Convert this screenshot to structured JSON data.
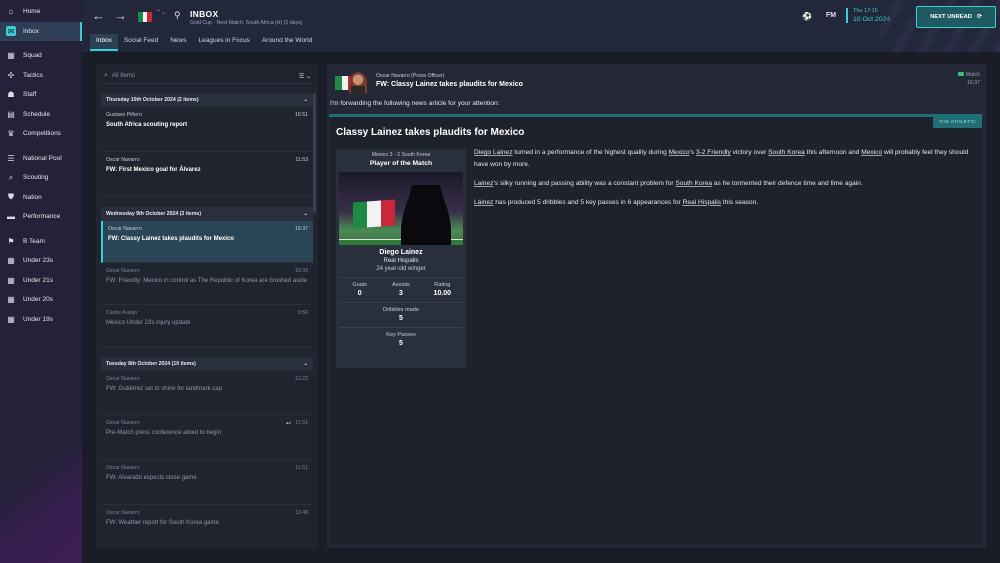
{
  "sidebar": {
    "items": [
      {
        "label": "Home",
        "icon": "home-icon",
        "glyph": "⌂"
      },
      {
        "label": "Inbox",
        "icon": "inbox-icon",
        "glyph": "✉"
      },
      {
        "label": "Squad",
        "icon": "squad-icon",
        "glyph": "▦"
      },
      {
        "label": "Tactics",
        "icon": "tactics-icon",
        "glyph": "✣"
      },
      {
        "label": "Staff",
        "icon": "staff-icon",
        "glyph": "☗"
      },
      {
        "label": "Schedule",
        "icon": "schedule-icon",
        "glyph": "▤"
      },
      {
        "label": "Competitions",
        "icon": "trophy-icon",
        "glyph": "♛"
      },
      {
        "label": "National Pool",
        "icon": "pool-icon",
        "glyph": "☰"
      },
      {
        "label": "Scouting",
        "icon": "scouting-icon",
        "glyph": "⌕"
      },
      {
        "label": "Nation",
        "icon": "nation-icon",
        "glyph": "⛊"
      },
      {
        "label": "Performance",
        "icon": "performance-icon",
        "glyph": "▬"
      },
      {
        "label": "B Team",
        "icon": "team-icon",
        "glyph": "⚑"
      },
      {
        "label": "Under 23s",
        "icon": "team-icon",
        "glyph": "▦"
      },
      {
        "label": "Under 21s",
        "icon": "team-icon",
        "glyph": "▦"
      },
      {
        "label": "Under 20s",
        "icon": "team-icon",
        "glyph": "▦"
      },
      {
        "label": "Under 19s",
        "icon": "team-icon",
        "glyph": "▦"
      }
    ]
  },
  "header": {
    "back": "←",
    "forward": "→",
    "search_glyph": "⚲",
    "title": "INBOX",
    "subtitle": "Gold Cup - Next Match: South Africa (H) (2 days)",
    "tabs": [
      "Inbox",
      "Social Feed",
      "News",
      "Leagues in Focus",
      "Around the World"
    ],
    "date_time": "Thu 17:15",
    "date": "10 Oct 2024",
    "fm_label": "FM",
    "next_button": "NEXT UNREAD",
    "next_glyph": "⟳",
    "ball_glyph": "⚽",
    "chevrons": "⌃⌄"
  },
  "list": {
    "search_placeholder": "All Items",
    "search_glyph": "⌕",
    "sort_label": "☰ ⌄",
    "chevron": "⌄",
    "reply_glyph": "↩",
    "groups": [
      {
        "header": "Thursday 10th October 2024 (2 items)",
        "messages": [
          {
            "from": "Gustavo Piñero",
            "time": "16:51",
            "subject": "South Africa scouting report",
            "read": false,
            "selected": false
          },
          {
            "from": "Oscar Navarro",
            "time": "11:53",
            "subject": "FW: First Mexico goal for Álvarez",
            "read": false,
            "selected": false
          }
        ]
      },
      {
        "header": "Wednesday 9th October 2024 (3 items)",
        "messages": [
          {
            "from": "Oscar Navarro",
            "time": "16:37",
            "subject": "FW: Classy Lainez takes plaudits for Mexico",
            "read": false,
            "selected": true
          },
          {
            "from": "Oscar Navarro",
            "time": "16:33",
            "subject": "FW: Friendly: Mexico in control as The Republic of Korea are brushed aside",
            "read": true,
            "selected": false
          },
          {
            "from": "Carlos Araujo",
            "time": "9:50",
            "subject": "Mexico Under 23s injury update",
            "read": true,
            "selected": false
          }
        ]
      },
      {
        "header": "Tuesday 8th October 2024 (10 items)",
        "messages": [
          {
            "from": "Oscar Navarro",
            "time": "12:23",
            "subject": "FW: Gutiérrez set to shine for landmark cap",
            "read": true,
            "selected": false
          },
          {
            "from": "Oscar Navarro",
            "time": "11:51",
            "subject": "Pre-Match press conference about to begin",
            "read": true,
            "selected": false
          },
          {
            "from": "Oscar Navarro",
            "time": "11:51",
            "subject": "FW: Alvarado expects close game",
            "read": true,
            "selected": false
          },
          {
            "from": "Oscar Navarro",
            "time": "11:48",
            "subject": "FW: Weather report for South Korea game",
            "read": true,
            "selected": false
          }
        ]
      }
    ]
  },
  "article": {
    "from": "Oscar Navarro  (Press Officer)",
    "subject": "FW: Classy Lainez takes plaudits for Mexico",
    "category": "Match",
    "time": "16:37",
    "intro": "I'm forwarding the following news article for your attention:",
    "source": "THE ATHLETIC",
    "title": "Classy Lainez takes plaudits for Mexico",
    "card": {
      "score": "Mexico 3 - 2 South Korea",
      "heading": "Player of the Match",
      "name": "Diego Lainez",
      "club": "Real Hispalis",
      "desc": "24 year-old winger",
      "goals_label": "Goals",
      "goals": "0",
      "assists_label": "Assists",
      "assists": "3",
      "rating_label": "Rating",
      "rating": "10.00",
      "dribbles_label": "Dribbles made",
      "dribbles": "5",
      "keypasses_label": "Key Passes",
      "keypasses": "5"
    },
    "p1": {
      "a": "Diego Lainez",
      "b": " turned in a performance of the highest quality during ",
      "c": "Mexico",
      "d": "'s ",
      "e": "3-2 Friendly",
      "f": " victory over ",
      "g": "South Korea",
      "h": " this afternoon and ",
      "i": "Mexico",
      "j": " will probably feel they should have won by more."
    },
    "p2": {
      "a": "Lainez",
      "b": "'s silky running and passing ability was a constant problem for ",
      "c": "South Korea",
      "d": " as he tormented their defence time and time again."
    },
    "p3": {
      "a": "Lainez",
      "b": " has produced 5 dribbles and 5 key passes in 6 appearances for ",
      "c": "Real Hispalis",
      "d": " this season."
    }
  },
  "colors": {
    "accent": "#3ad0d0",
    "mexico_green": "#1e8a45",
    "mexico_white": "#f2f2f2",
    "mexico_red": "#c8283a"
  }
}
